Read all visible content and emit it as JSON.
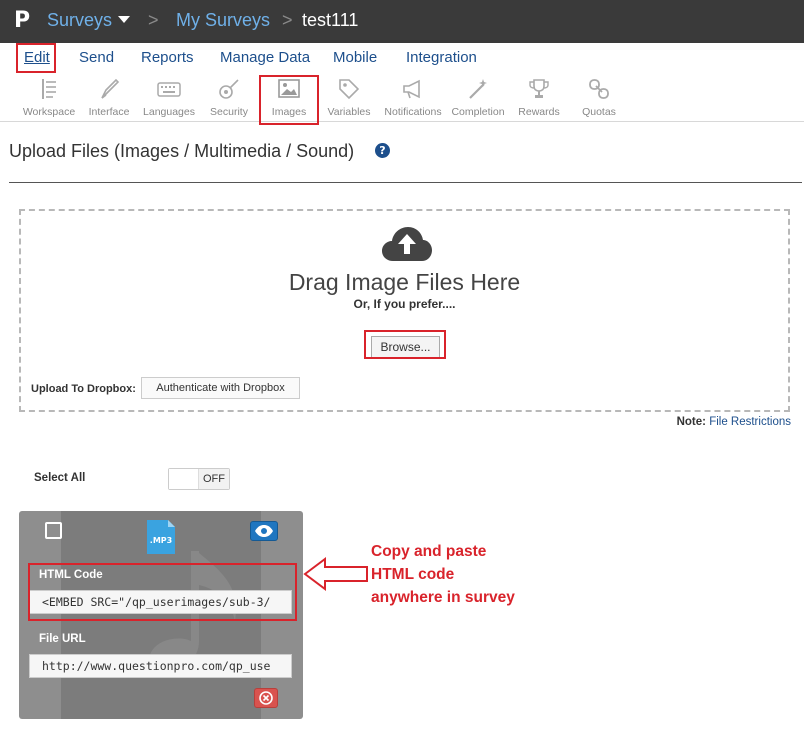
{
  "topbar": {
    "logo": "P",
    "breadcrumbs": [
      "Surveys",
      "My Surveys",
      "test111"
    ],
    "separator": ">"
  },
  "mainnav": {
    "items": [
      "Edit",
      "Send",
      "Reports",
      "Manage Data",
      "Mobile",
      "Integration"
    ],
    "active": "Edit"
  },
  "toolbar": {
    "items": [
      {
        "label": "Workspace",
        "icon": "workspace-icon"
      },
      {
        "label": "Interface",
        "icon": "interface-icon"
      },
      {
        "label": "Languages",
        "icon": "keyboard-icon"
      },
      {
        "label": "Security",
        "icon": "security-icon"
      },
      {
        "label": "Images",
        "icon": "image-icon"
      },
      {
        "label": "Variables",
        "icon": "tag-icon"
      },
      {
        "label": "Notifications",
        "icon": "megaphone-icon"
      },
      {
        "label": "Completion",
        "icon": "wand-icon"
      },
      {
        "label": "Rewards",
        "icon": "trophy-icon"
      },
      {
        "label": "Quotas",
        "icon": "link-icon"
      }
    ],
    "selected": "Images"
  },
  "page": {
    "title": "Upload Files (Images / Multimedia / Sound)",
    "help": "?"
  },
  "dropzone": {
    "title": "Drag Image Files Here",
    "subtitle": "Or, If you prefer....",
    "browse_label": "Browse...",
    "dropbox_label": "Upload To Dropbox:",
    "dropbox_button": "Authenticate with Dropbox"
  },
  "note": {
    "label": "Note:",
    "link": "File Restrictions"
  },
  "select_all": {
    "label": "Select All",
    "toggle_state": "OFF"
  },
  "file_card": {
    "file_type": ".MP3",
    "html_code_label": "HTML Code",
    "html_code_value": "<EMBED SRC=\"/qp_userimages/sub-3/",
    "file_url_label": "File URL",
    "file_url_value": "http://www.questionpro.com/qp_use"
  },
  "annotation": {
    "lines": [
      "Copy and paste",
      "HTML code",
      "anywhere in survey"
    ],
    "color": "#d9232b"
  },
  "colors": {
    "topbar": "#3a3a3a",
    "link": "#1d4f8c",
    "highlight": "#d9232b",
    "card": "#8e8e8e"
  }
}
